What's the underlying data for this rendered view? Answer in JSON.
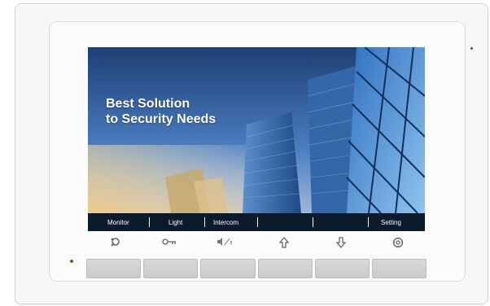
{
  "screen": {
    "headline_line1": "Best Solution",
    "headline_line2": "to Security Needs"
  },
  "menu": {
    "items": [
      {
        "label": "Monitor"
      },
      {
        "label": "Light"
      },
      {
        "label": "Intercom"
      },
      {
        "label": ""
      },
      {
        "label": ""
      },
      {
        "label": "Setting"
      }
    ]
  },
  "buttons": {
    "icons": [
      "unlock-icon",
      "key-icon",
      "volume-icon",
      "up-arrow-icon",
      "down-arrow-icon",
      "settings-icon"
    ]
  },
  "colors": {
    "menubar": "#0c1a2e",
    "sky": "#2b5fa6",
    "panel": "#f7f7f7",
    "led": "#6a5a2a"
  }
}
